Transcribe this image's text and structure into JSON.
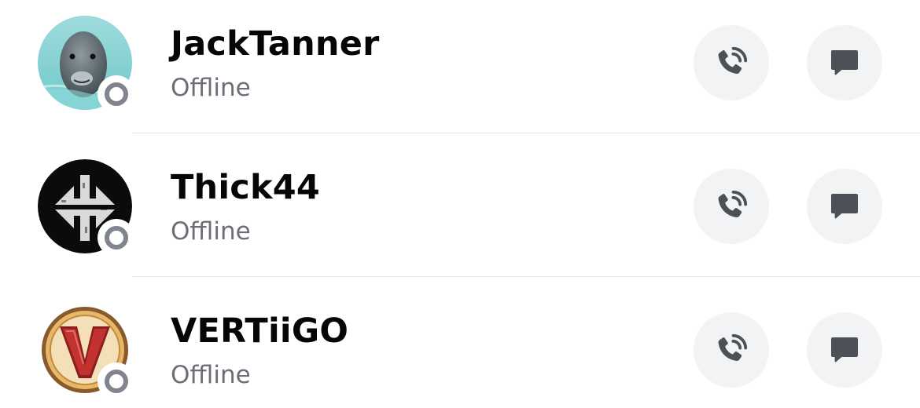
{
  "friends": [
    {
      "name": "JackTanner",
      "status": "Offline",
      "avatar_icon": "dolphin-avatar",
      "call_icon": "phone-call-icon",
      "message_icon": "chat-bubble-icon"
    },
    {
      "name": "Thick44",
      "status": "Offline",
      "avatar_icon": "arrows-emblem-avatar",
      "call_icon": "phone-call-icon",
      "message_icon": "chat-bubble-icon"
    },
    {
      "name": "VERTiiGO",
      "status": "Offline",
      "avatar_icon": "v-badge-avatar",
      "call_icon": "phone-call-icon",
      "message_icon": "chat-bubble-icon"
    }
  ],
  "colors": {
    "name_text": "#060607",
    "status_text": "#6d6f78",
    "button_bg": "#f2f3f5",
    "icon": "#4e5058",
    "offline_ring": "#80848e",
    "divider": "#e3e5e8"
  }
}
